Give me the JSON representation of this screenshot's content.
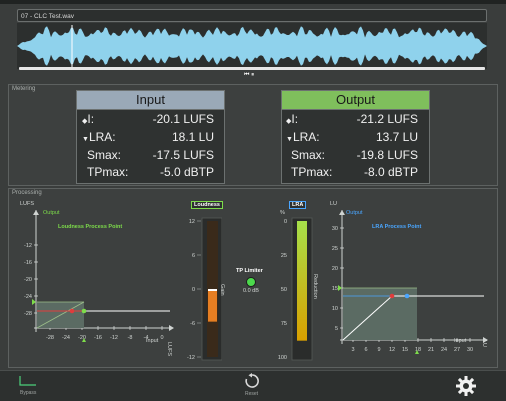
{
  "file": {
    "name": "07 - CLC Test.wav"
  },
  "transport": {
    "glyph": "⏮ ⏸"
  },
  "sections": {
    "metering": "Metering",
    "processing": "Processing"
  },
  "input_meter": {
    "title": "Input",
    "rows": [
      {
        "label": "I:",
        "value": "-20.1 LUFS"
      },
      {
        "label": "LRA:",
        "value": "18.1 LU"
      },
      {
        "label": "Smax:",
        "value": "-17.5 LUFS"
      },
      {
        "label": "TPmax:",
        "value": "-5.0 dBTP"
      }
    ]
  },
  "output_meter": {
    "title": "Output",
    "rows": [
      {
        "label": "I:",
        "value": "-21.2 LUFS"
      },
      {
        "label": "LRA:",
        "value": "13.7 LU"
      },
      {
        "label": "Smax:",
        "value": "-19.8 LUFS"
      },
      {
        "label": "TPmax:",
        "value": "-8.0 dBTP"
      }
    ]
  },
  "loudness_graph": {
    "y_unit": "LUFS",
    "x_unit": "LUFS",
    "output_label": "Output",
    "input_label": "Input",
    "title": "Loudness Process Point",
    "y_ticks": [
      "-12",
      "-16",
      "-20",
      "-24",
      "-28"
    ],
    "x_ticks": [
      "-28",
      "-24",
      "-20",
      "-16",
      "-12",
      "-8",
      "-4",
      "0"
    ]
  },
  "loudness_meter": {
    "label": "Loudness",
    "ticks": [
      "12",
      "6",
      "0",
      "-6",
      "-12"
    ],
    "side_label": "Gain",
    "gain_bar_color": "#e67e22",
    "value_fraction": 0.24
  },
  "tp_limiter": {
    "label": "TP Limiter",
    "value": "0.0 dB",
    "led_color": "#4cd94c"
  },
  "lra_meter": {
    "label": "LRA",
    "unit": "%",
    "ticks": [
      "0",
      "25",
      "50",
      "75",
      "100"
    ],
    "side_label": "Reduction",
    "bar_color_top": "#a6e04a",
    "bar_color_bottom": "#d9a000",
    "value_fraction": 0.88
  },
  "lra_graph": {
    "y_unit": "LU",
    "x_unit": "LU",
    "output_label": "Output",
    "input_label": "Input",
    "title": "LRA Process Point",
    "y_ticks": [
      "30",
      "25",
      "20",
      "15",
      "10",
      "5"
    ],
    "x_ticks": [
      "3",
      "6",
      "9",
      "12",
      "15",
      "18",
      "21",
      "24",
      "27",
      "30"
    ]
  },
  "footer": {
    "bypass": "Bypass",
    "reset": "Reset"
  },
  "colors": {
    "input_header": "#9aa9b7",
    "output_header": "#7fbf5c",
    "waveform": "#8fd2ec",
    "loudness_title": "#7ddc4a",
    "lra_title": "#4aa6ff",
    "graph_fill": "#5b6b63"
  }
}
